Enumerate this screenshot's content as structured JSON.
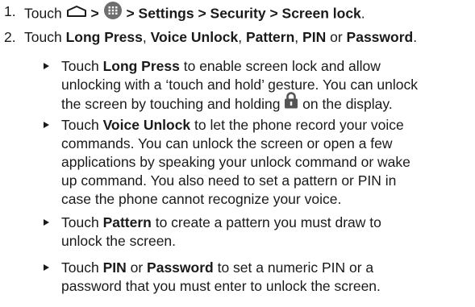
{
  "steps": [
    {
      "number": "1.",
      "touch": "Touch",
      "sep1": ">",
      "sep2": ">",
      "path": "Settings > Security > Screen lock",
      "end": "."
    },
    {
      "number": "2.",
      "touch": "Touch",
      "opt1": "Long Press",
      "c1": ",",
      "opt2": "Voice Unlock",
      "c2": ",",
      "opt3": "Pattern",
      "c3": ",",
      "opt4": "PIN",
      "or": "or",
      "opt5": "Password",
      "end": "."
    }
  ],
  "bullets": [
    {
      "lines": [
        {
          "pre": "Touch ",
          "bold": "Long Press",
          "post": " to enable screen lock and allow"
        },
        {
          "text": "unlocking with a ‘touch and hold’ gesture. You can unlock"
        },
        {
          "pre": "the screen by touching and holding ",
          "post": " on the display."
        }
      ]
    },
    {
      "lines": [
        {
          "pre": "Touch ",
          "bold": "Voice Unlock",
          "post": " to let the phone record your voice"
        },
        {
          "text": "commands. You can unlock the screen or open a few"
        },
        {
          "text": "applications by speaking your unlock command or wake"
        },
        {
          "text": "up command. You also need to set a pattern or PIN in"
        },
        {
          "text": "case the phone cannot recognize your voice."
        }
      ]
    },
    {
      "lines": [
        {
          "pre": "Touch ",
          "bold": "Pattern",
          "post": " to create a pattern you must draw to"
        },
        {
          "text": "unlock the screen."
        }
      ]
    },
    {
      "lines": [
        {
          "pre": "Touch ",
          "bold": "PIN",
          "mid": " or ",
          "bold2": "Password",
          "post": " to set a numeric PIN or a"
        },
        {
          "text": "password that you must enter to unlock the screen."
        }
      ]
    }
  ],
  "icons": {
    "home": "home-icon",
    "apps": "apps-icon",
    "lock": "lock-icon"
  },
  "colors": {
    "text": "#1a1a1a",
    "lock_icon": "#555555",
    "apps_icon": "#6e6e6e"
  }
}
